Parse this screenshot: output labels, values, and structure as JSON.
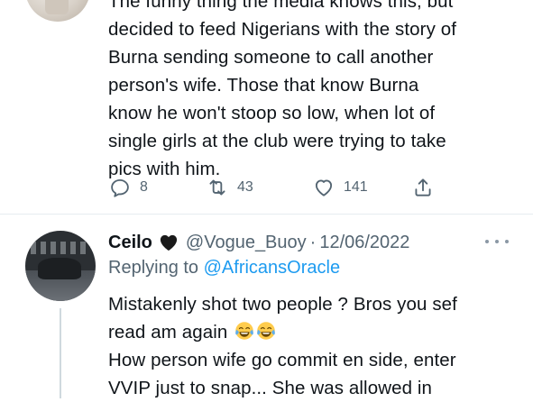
{
  "tweet": {
    "body_lines": [
      "The funny thing the media knows this, but",
      "decided to feed Nigerians with the story of",
      "Burna sending someone to call another",
      "person's wife. Those that know Burna",
      "know he won't stoop so low, when lot of",
      "single girls at the club were trying to take",
      "pics with him."
    ],
    "actions": {
      "reply_count": "8",
      "retweet_count": "43",
      "like_count": "141"
    }
  },
  "reply": {
    "name": "Ceilo",
    "handle": "@Vogue_Buoy",
    "separator": "·",
    "date": "12/06/2022",
    "replying_prefix": "Replying to",
    "replying_to": "@AfricansOracle",
    "body_lines": [
      "Mistakenly shot two people ? Bros you sef",
      "read am again",
      "How person wife go commit en side, enter",
      "VVIP just to snap... She was allowed in"
    ],
    "emojis": [
      "face-with-tears-of-joy",
      "face-with-tears-of-joy"
    ]
  },
  "colors": {
    "text": "#0f1419",
    "muted": "#536471",
    "link": "#1d9bf0",
    "divider": "#e6ecf0"
  },
  "icons": [
    "reply-icon",
    "retweet-icon",
    "like-icon",
    "share-icon",
    "black-heart-icon",
    "more-icon"
  ]
}
